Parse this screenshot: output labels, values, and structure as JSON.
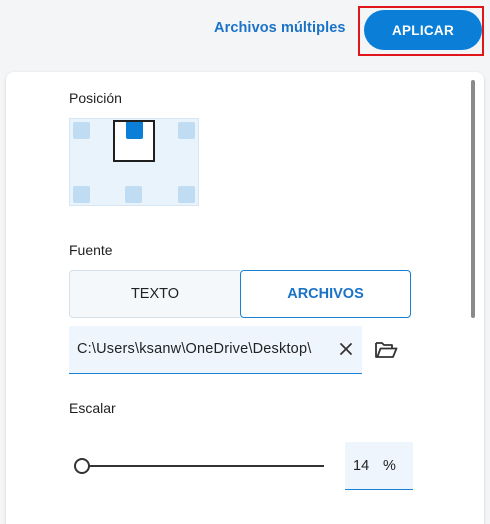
{
  "header": {
    "multiple_files_link": "Archivos múltiples",
    "apply_button": "APLICAR"
  },
  "position": {
    "label": "Posición",
    "selected": "top-center"
  },
  "source": {
    "label": "Fuente",
    "options": [
      "TEXTO",
      "ARCHIVOS"
    ],
    "selected": "ARCHIVOS",
    "path_value": "C:\\Users\\ksanw\\OneDrive\\Desktop\\",
    "clear_icon": "close-icon",
    "browse_icon": "folder-open-icon"
  },
  "scale": {
    "label": "Escalar",
    "value": "14",
    "unit": "%"
  },
  "colors": {
    "accent": "#0b7fd8",
    "highlight_border": "#e0161b"
  }
}
